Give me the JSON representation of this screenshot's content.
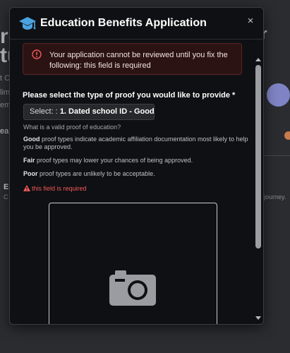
{
  "background": {
    "frag_big_1": "re",
    "frag_big_2": "tu",
    "frag_r": "r",
    "frag_c": "t C",
    "frag_lim": "lim",
    "frag_em": "em",
    "frag_ea": "ea",
    "frag_e": "E",
    "frag_cc": "C",
    "frag_journey": "journey."
  },
  "modal": {
    "title": "Education Benefits Application",
    "close_label": "×",
    "alert_text": "Your application cannot be reviewed until you fix the following: this field is required",
    "field_label": "Please select the type of proof you would like to provide *",
    "select_prefix": "Select: :",
    "select_value": "1. Dated school ID - Good",
    "help_question": "What is a valid proof of education?",
    "help_good_strong": "Good",
    "help_good_rest": " proof types indicate academic affiliation documentation most likely to help you be approved.",
    "help_fair_strong": "Fair",
    "help_fair_rest": " proof types may lower your chances of being approved.",
    "help_poor_strong": "Poor",
    "help_poor_rest": " proof types are unlikely to be acceptable.",
    "error_text": "this field is required"
  },
  "icons": {
    "title_icon": "graduation-cap-icon",
    "alert_icon": "error-circle-icon",
    "error_icon": "warning-triangle-icon",
    "upload_icon": "camera-icon"
  },
  "colors": {
    "accent_blue": "#4aa3e0",
    "error_red": "#f1595b",
    "modal_bg": "#0f1013"
  }
}
